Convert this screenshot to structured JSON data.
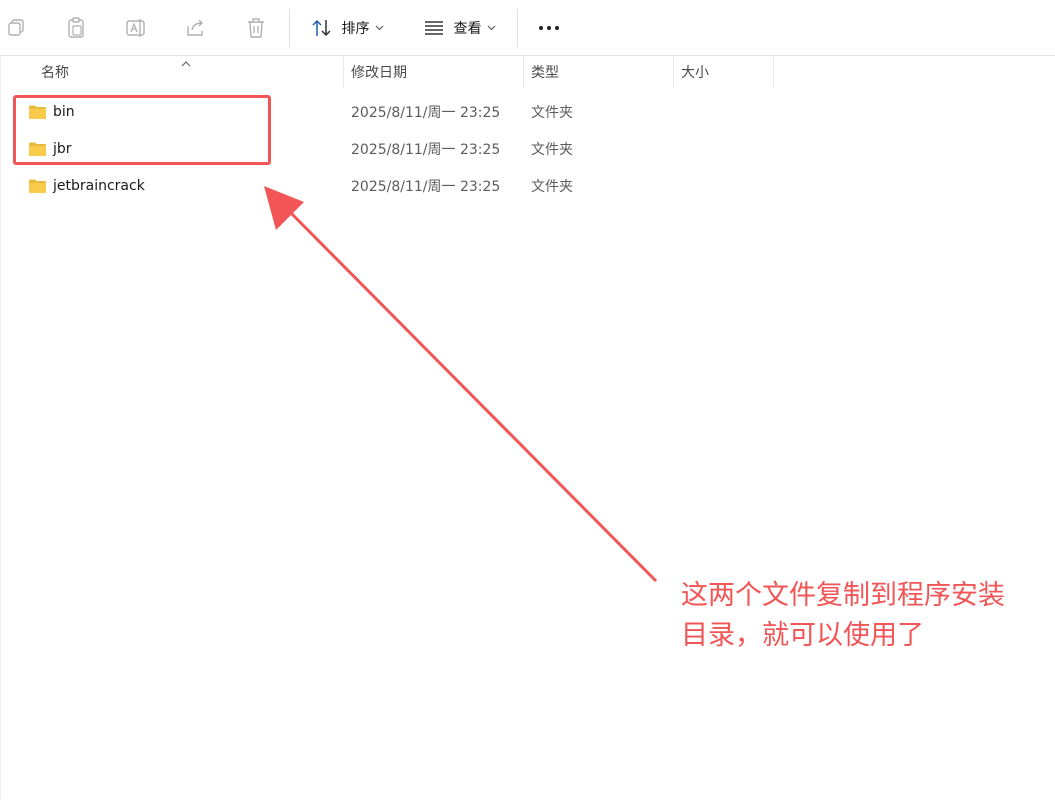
{
  "toolbar": {
    "sort_label": "排序",
    "view_label": "查看",
    "more_label": "···",
    "icons": [
      "copy-icon",
      "paste-icon",
      "rename-icon",
      "share-icon",
      "delete-icon",
      "sort-icon",
      "view-icon",
      "more-icon"
    ]
  },
  "columns": {
    "name": "名称",
    "modified": "修改日期",
    "type": "类型",
    "size": "大小"
  },
  "files": [
    {
      "name": "bin",
      "modified": "2025/8/11/周一 23:25",
      "type": "文件夹",
      "size": ""
    },
    {
      "name": "jbr",
      "modified": "2025/8/11/周一 23:25",
      "type": "文件夹",
      "size": ""
    },
    {
      "name": "jetbraincrack",
      "modified": "2025/8/11/周一 23:25",
      "type": "文件夹",
      "size": ""
    }
  ],
  "annotation": {
    "line1": "这两个文件复制到程序安装",
    "line2": "目录，就可以使用了",
    "color": "#f25555"
  },
  "colors": {
    "folder_body": "#f8cc4a",
    "folder_tab": "#e9b93b",
    "icon_gray": "#9a9a9a"
  }
}
